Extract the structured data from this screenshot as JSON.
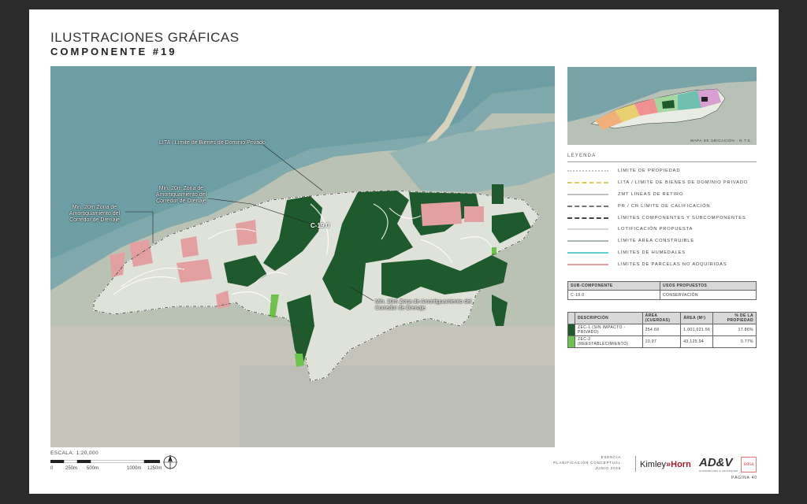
{
  "header": {
    "title_line1": "ILUSTRACIONES GRÁFICAS",
    "title_line2": "COMPONENTE #19"
  },
  "map": {
    "component_label": "C-19.0",
    "annotations": [
      "LITA / Límite de Bienes de Dominio Privado",
      "Min. 20m Zona de Amortiguamiento del Corredor de Drenaje",
      "Min. 20m Zona de Amortiguamiento del Corredor de Drenaje",
      "Min. 20m Zona de Amortiguamiento del Corredor de Drenaje"
    ]
  },
  "inset": {
    "caption": "MAPA DE UBICACIÓN - N.T.S."
  },
  "legend": {
    "title": "LEYENDA",
    "items": [
      {
        "label": "LÍMITE DE PROPIEDAD",
        "color": "#c8c8c8",
        "style": "dotted"
      },
      {
        "label": "LITA / LÍMITE DE BIENES DE DOMINIO PRIVADO",
        "color": "#d8d060",
        "style": "dashed"
      },
      {
        "label": "ZMT LÍNEAS DE RETIRO",
        "color": "#c0c0c0",
        "style": "solid"
      },
      {
        "label": "PR / CR LÍMITE DE CALIFICACIÓN",
        "color": "#777777",
        "style": "dashed"
      },
      {
        "label": "LÍMITES COMPONENTES Y SUBCOMPONENTES",
        "color": "#444444",
        "style": "dashdot"
      },
      {
        "label": "LOTIFICACIÓN PROPUESTA",
        "color": "#d8d8d8",
        "style": "solid"
      },
      {
        "label": "LÍMITE ÁREA CONSTRUIBLE",
        "color": "#aab8b0",
        "style": "solid"
      },
      {
        "label": "LÍMITES DE HUMEDALES",
        "color": "#60d0d0",
        "style": "solid"
      },
      {
        "label": "LÍMITES DE PARCELAS NO ADQUIRIDAS",
        "color": "#e6a0a0",
        "style": "solid"
      }
    ]
  },
  "uses_table": {
    "headers": [
      "SUB-COMPONENTE",
      "USOS PROPUESTOS"
    ],
    "rows": [
      [
        "C-19.0",
        "CONSERVACIÓN"
      ]
    ]
  },
  "area_table": {
    "headers": [
      "DESCRIPCIÓN",
      "ÁREA (CUERDAS)",
      "ÁREA (M²)",
      "% DE LA PROPIEDAD"
    ],
    "rows": [
      {
        "color": "#1f5a2c",
        "desc": "ZEC-1 (SIN IMPACTO - PRIVADO)",
        "cuerdas": "254.69",
        "m2": "1,001,021.56",
        "pct": "17.86%"
      },
      {
        "color": "#6cc24a",
        "desc": "ZEC-2 (REESTABLECIMIENTO)",
        "cuerdas": "10.97",
        "m2": "43,125.94",
        "pct": "0.77%"
      }
    ]
  },
  "scale": {
    "label": "ESCALA: 1:20,000",
    "ticks": [
      "0",
      "250m",
      "500m",
      "1000m",
      "1250m"
    ]
  },
  "footer": {
    "project": "ESENCIA",
    "doc": "PLANIFICACIÓN CONCEPTUAL",
    "date": "JUNIO 2026",
    "logo1_a": "Kimley",
    "logo1_b": "»Horn",
    "logo2": "AD&V",
    "logo2_sub": "ALMAREZ DEV & VELAZQUEZ",
    "logo3": "edsa",
    "page": "PÁGINA 40"
  }
}
